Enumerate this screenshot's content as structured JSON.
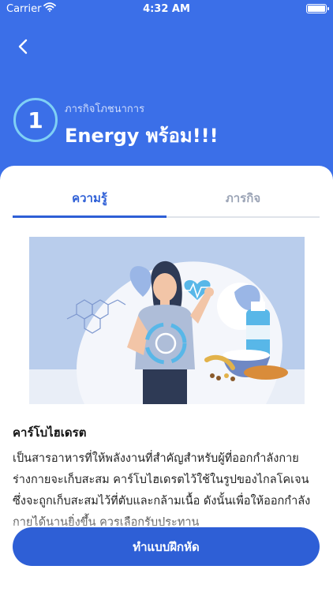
{
  "status_bar": {
    "carrier": "Carrier",
    "time": "4:32 AM"
  },
  "header": {
    "mission_number": "1",
    "subtitle": "ภารกิจโภชนาการ",
    "title": "Energy พร้อม!!!"
  },
  "tabs": [
    {
      "label": "ความรู้",
      "active": true
    },
    {
      "label": "ภารกิจ",
      "active": false
    }
  ],
  "content": {
    "section_title": "คาร์โบไฮเดรต",
    "body": "เป็นสารอาหารที่ให้พลังงานที่สำคัญสำหรับผู้ที่ออกกำลังกาย ร่างกายจะเก็บสะสม คาร์โบไฮเดรตไว้ใช้ในรูปของไกลโคเจน ซึ่งจะถูกเก็บสะสมไว้ที่ตับและกล้ามเนื้อ ดังนั้นเพื่อให้ออกกำลังกายได้นานยิ่งขึ้น ควรเลือกรับประทาน"
  },
  "actions": {
    "practice_label": "ทำแบบฝึกหัด"
  },
  "colors": {
    "primary": "#3b6fe8",
    "accent": "#2e5fd6",
    "badge_ring": "#7fd0f5"
  }
}
